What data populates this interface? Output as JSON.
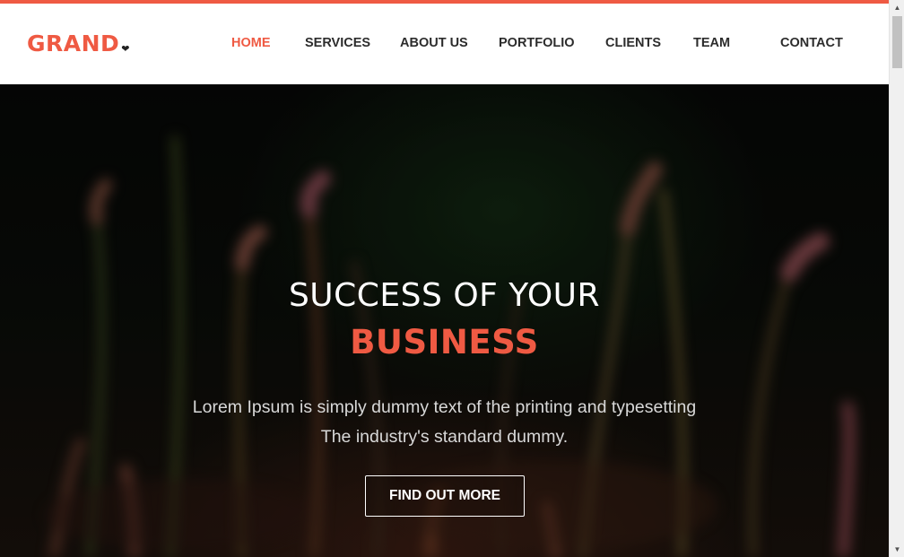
{
  "brand": {
    "name": "GRAND",
    "mark": "❤",
    "accent_color": "#ef5a43"
  },
  "nav": {
    "items": [
      {
        "label": "HOME",
        "active": true
      },
      {
        "label": "SERVICES"
      },
      {
        "label": "ABOUT US"
      },
      {
        "label": "PORTFOLIO"
      },
      {
        "label": "CLIENTS"
      },
      {
        "label": "TEAM"
      },
      {
        "label": "CONTACT"
      }
    ]
  },
  "hero": {
    "title_line1": "SUCCESS OF YOUR",
    "title_line2": "BUSINESS",
    "text_line1": "Lorem Ipsum is simply dummy text of the printing and typesetting",
    "text_line2": "The industry's standard dummy.",
    "button_label": "FIND OUT MORE",
    "background": "blurred grass stems"
  },
  "scrollbar": {
    "up_icon": "scroll-up-arrow",
    "down_icon": "scroll-down-arrow"
  }
}
